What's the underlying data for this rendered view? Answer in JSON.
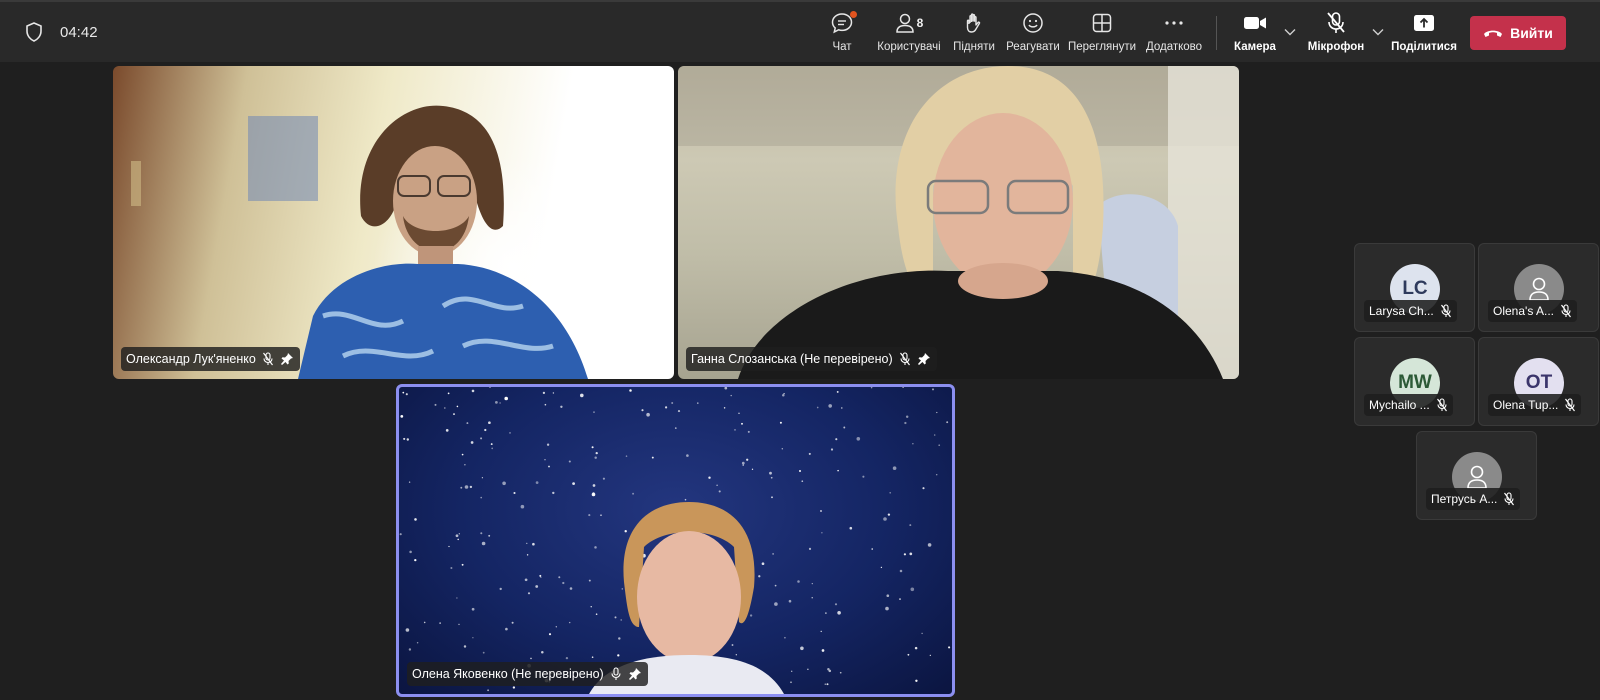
{
  "meeting": {
    "timer": "04:42"
  },
  "toolbar": {
    "chat_label": "Чат",
    "people_label": "Користувачі",
    "people_count": "8",
    "raise_label": "Підняти",
    "react_label": "Реагувати",
    "view_label": "Переглянути",
    "more_label": "Додатково",
    "camera_label": "Камера",
    "mic_label": "Мікрофон",
    "share_label": "Поділитися",
    "leave_label": "Вийти"
  },
  "video_tiles": [
    {
      "name": "Олександр Лук'яненко",
      "muted": true,
      "pinned": true
    },
    {
      "name": "Ганна Слозанська (Не перевірено)",
      "muted": true,
      "pinned": true
    },
    {
      "name": "Олена Яковенко (Не перевірено)",
      "muted": false,
      "pinned": true
    }
  ],
  "participants": [
    {
      "name": "Larysa Ch...",
      "initials": "LC",
      "avatar_color": "#dde3ee",
      "initials_color": "#2e3a5c"
    },
    {
      "name": "Olena's A...",
      "initials": "",
      "avatar_color": "#8a8a8a",
      "initials_color": "#ffffff"
    },
    {
      "name": "Mychailo ...",
      "initials": "MW",
      "avatar_color": "#d5e6d8",
      "initials_color": "#2c5a36"
    },
    {
      "name": "Olena Tup...",
      "initials": "OT",
      "avatar_color": "#e3e0f0",
      "initials_color": "#3b356b"
    },
    {
      "name": "Петрусь А...",
      "initials": "",
      "avatar_color": "#8a8a8a",
      "initials_color": "#ffffff"
    }
  ],
  "colors": {
    "background": "#1f1f1f",
    "topbar": "#292929",
    "leave": "#c4314b",
    "active_speaker": "#8c8ff0",
    "notification": "#e2541f"
  }
}
